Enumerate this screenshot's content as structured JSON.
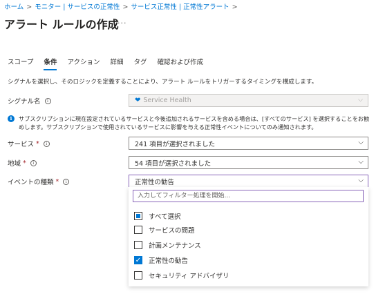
{
  "breadcrumb": [
    "ホーム",
    "モニター | サービスの正常性",
    "サービス正常性 | 正常性アラート"
  ],
  "page_title": "アラート ルールの作成",
  "more_glyph": "···",
  "tabs": [
    {
      "label": "スコープ",
      "active": false
    },
    {
      "label": "条件",
      "active": true
    },
    {
      "label": "アクション",
      "active": false
    },
    {
      "label": "詳細",
      "active": false
    },
    {
      "label": "タグ",
      "active": false
    },
    {
      "label": "確認および作成",
      "active": false
    }
  ],
  "description": "シグナルを選択し、そのロジックを定義することにより、アラート ルールをトリガーするタイミングを構成します。",
  "signal": {
    "label": "シグナル名",
    "value": "Service Health"
  },
  "info_message": "サブスクリプションに現在設定されているサービスと今後追加されるサービスを含める場合は、[すべてのサービス] を選択することをお勧めします。サブスクリプションで使用されているサービスに影響を与える正常性イベントについてのみ通知されます。",
  "service": {
    "label": "サービス",
    "value": "241 項目が選択されました"
  },
  "region": {
    "label": "地域",
    "value": "54 項目が選択されました"
  },
  "event_type": {
    "label": "イベントの種類",
    "value": "正常性の勧告",
    "filter_placeholder": "入力してフィルター処理を開始...",
    "options": [
      {
        "label": "すべて選択",
        "state": "partial"
      },
      {
        "label": "サービスの問題",
        "state": "unchecked"
      },
      {
        "label": "計画メンテナンス",
        "state": "unchecked"
      },
      {
        "label": "正常性の勧告",
        "state": "checked"
      },
      {
        "label": "セキュリティ アドバイザリ",
        "state": "unchecked"
      }
    ]
  },
  "colors": {
    "accent": "#0078d4",
    "focus": "#8764b8",
    "required": "#a4262c"
  }
}
